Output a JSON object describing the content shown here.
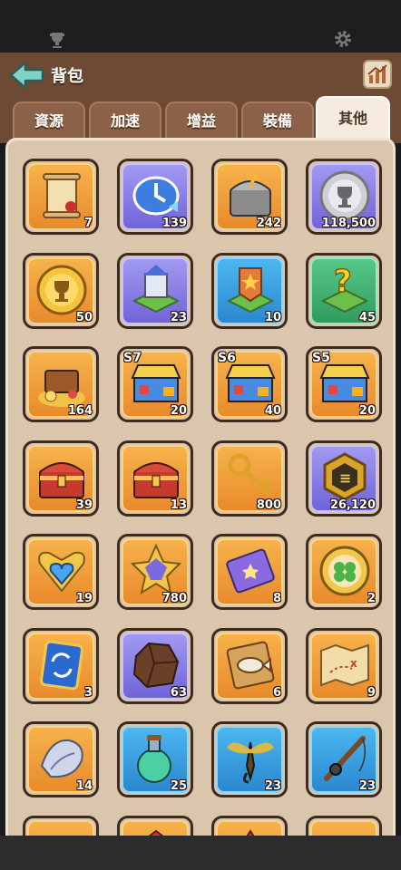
{
  "header": {
    "title": "背包"
  },
  "tabs": [
    {
      "label": "資源",
      "active": false
    },
    {
      "label": "加速",
      "active": false
    },
    {
      "label": "增益",
      "active": false
    },
    {
      "label": "裝備",
      "active": false
    },
    {
      "label": "其他",
      "active": true
    }
  ],
  "items": [
    {
      "icon": "scroll-icon",
      "count": "7",
      "frame": "orange"
    },
    {
      "icon": "speedup-clock-icon",
      "count": "139",
      "frame": "purple"
    },
    {
      "icon": "treasure-chest-icon",
      "count": "242",
      "frame": "orange"
    },
    {
      "icon": "silver-trophy-coin-icon",
      "count": "118,500",
      "frame": "purple"
    },
    {
      "icon": "gold-trophy-coin-icon",
      "count": "50",
      "frame": "orange"
    },
    {
      "icon": "castle-teleport-icon",
      "count": "23",
      "frame": "purple"
    },
    {
      "icon": "star-teleport-icon",
      "count": "10",
      "frame": "blue"
    },
    {
      "icon": "random-teleport-icon",
      "count": "45",
      "frame": "green"
    },
    {
      "icon": "treasure-pile-icon",
      "count": "164",
      "frame": "orange"
    },
    {
      "icon": "season-shop-icon",
      "season": "S7",
      "count": "20",
      "frame": "orange"
    },
    {
      "icon": "season-shop-icon",
      "season": "S6",
      "count": "40",
      "frame": "orange"
    },
    {
      "icon": "season-shop-icon",
      "season": "S5",
      "count": "20",
      "frame": "orange"
    },
    {
      "icon": "red-chest-icon",
      "count": "39",
      "frame": "orange"
    },
    {
      "icon": "red-chest-icon",
      "count": "13",
      "frame": "orange"
    },
    {
      "icon": "gold-key-icon",
      "count": "800",
      "frame": "orange"
    },
    {
      "icon": "hexagon-medal-icon",
      "count": "26,120",
      "frame": "purple"
    },
    {
      "icon": "heart-badge-icon",
      "count": "19",
      "frame": "orange"
    },
    {
      "icon": "star-gem-icon",
      "count": "780",
      "frame": "orange"
    },
    {
      "icon": "purple-ticket-icon",
      "count": "8",
      "frame": "orange"
    },
    {
      "icon": "clover-coin-icon",
      "count": "2",
      "frame": "orange"
    },
    {
      "icon": "exchange-card-icon",
      "count": "3",
      "frame": "orange"
    },
    {
      "icon": "ore-rock-icon",
      "count": "63",
      "frame": "purple"
    },
    {
      "icon": "fish-card-icon",
      "count": "6",
      "frame": "orange"
    },
    {
      "icon": "treasure-map-icon",
      "count": "9",
      "frame": "orange"
    },
    {
      "icon": "seashell-icon",
      "count": "14",
      "frame": "orange"
    },
    {
      "icon": "potion-bottle-icon",
      "count": "25",
      "frame": "blue"
    },
    {
      "icon": "fishing-lure-icon",
      "count": "23",
      "frame": "blue"
    },
    {
      "icon": "fishing-rod-icon",
      "count": "23",
      "frame": "blue"
    },
    {
      "icon": "gold-coin-icon",
      "count": "",
      "frame": "orange"
    },
    {
      "icon": "red-flag-icon",
      "count": "",
      "frame": "orange"
    },
    {
      "icon": "red-firework-icon",
      "count": "",
      "frame": "orange"
    },
    {
      "icon": "red-bow-icon",
      "count": "",
      "frame": "orange"
    }
  ]
}
